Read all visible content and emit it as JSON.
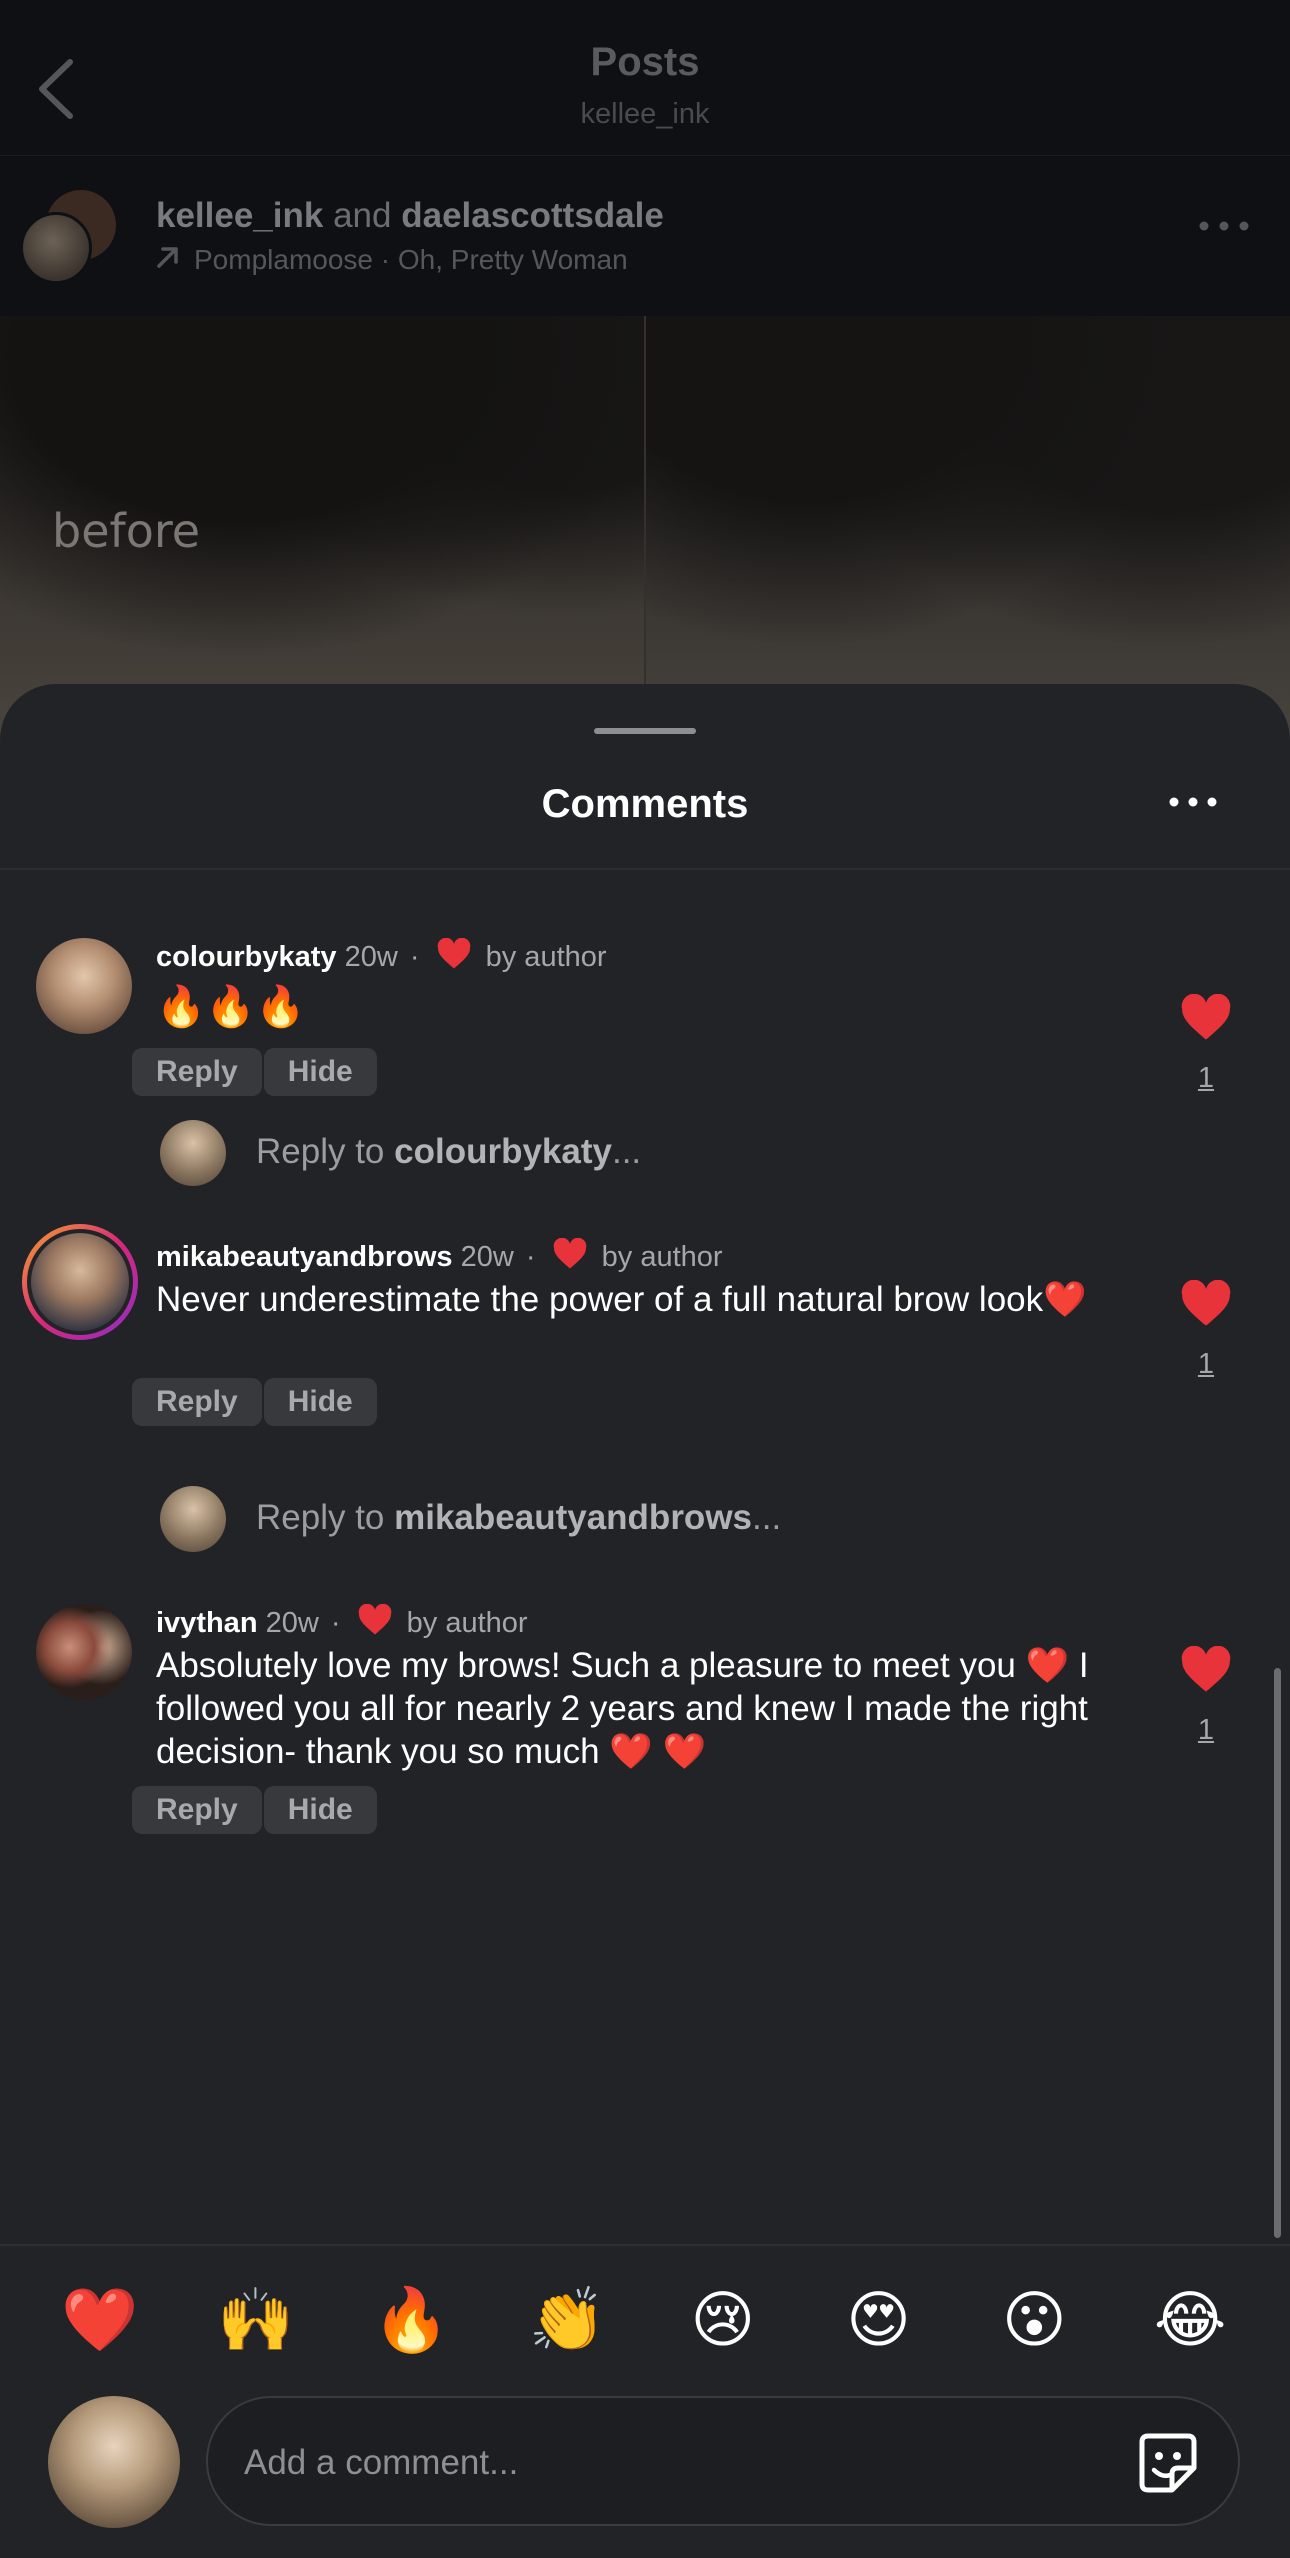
{
  "header": {
    "title": "Posts",
    "subtitle": "kellee_ink"
  },
  "post": {
    "author": "kellee_ink",
    "and_word": "and",
    "collaborator": "daelascottsdale",
    "music": "Pomplamoose · Oh, Pretty Woman",
    "image_overlay_text": "before"
  },
  "sheet": {
    "title": "Comments"
  },
  "comments": [
    {
      "username": "colourbykaty",
      "age": "20w",
      "dot": "·",
      "author_like": "by author",
      "text": "🔥🔥🔥",
      "reply_label": "Reply",
      "hide_label": "Hide",
      "like_count": "1",
      "reply_prompt_prefix": "Reply to ",
      "reply_prompt_user": "colourbykaty",
      "reply_prompt_suffix": "..."
    },
    {
      "username": "mikabeautyandbrows",
      "age": "20w",
      "dot": "·",
      "author_like": "by author",
      "text": "Never underestimate the power of a full natural brow look❤️",
      "reply_label": "Reply",
      "hide_label": "Hide",
      "like_count": "1",
      "reply_prompt_prefix": "Reply to ",
      "reply_prompt_user": "mikabeautyandbrows",
      "reply_prompt_suffix": "..."
    },
    {
      "username": "ivythan",
      "age": "20w",
      "dot": "·",
      "author_like": "by author",
      "text": "Absolutely love my brows! Such a pleasure to meet you ❤️ I followed you all for nearly 2 years and knew I made the right decision- thank you so much ❤️ ❤️",
      "reply_label": "Reply",
      "hide_label": "Hide",
      "like_count": "1"
    }
  ],
  "reactions": [
    "❤️",
    "🙌",
    "🔥",
    "👏",
    "😢",
    "😍",
    "😮",
    "😂"
  ],
  "composer": {
    "placeholder": "Add a comment..."
  },
  "colors": {
    "background": "#0a0b0d",
    "sheet": "#222327",
    "like_red": "#e8333b",
    "text_secondary": "#a6a7ab"
  },
  "icons": {
    "back": "chevron-left-icon",
    "music": "arrow-up-right-icon",
    "more": "more-horizontal-icon",
    "like": "heart-icon",
    "sticker": "sticker-icon"
  }
}
